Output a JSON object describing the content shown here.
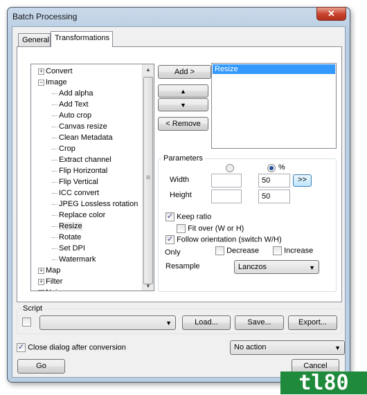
{
  "window": {
    "title": "Batch Processing",
    "close_icon": "close-icon"
  },
  "tabs": [
    {
      "label": "General",
      "active": false
    },
    {
      "label": "Transformations",
      "active": true
    }
  ],
  "tree": {
    "items": [
      {
        "label": "Convert",
        "level": 0,
        "expander": "+"
      },
      {
        "label": "Image",
        "level": 0,
        "expander": "-"
      },
      {
        "label": "Add alpha",
        "level": 1
      },
      {
        "label": "Add Text",
        "level": 1
      },
      {
        "label": "Auto crop",
        "level": 1
      },
      {
        "label": "Canvas resize",
        "level": 1
      },
      {
        "label": "Clean Metadata",
        "level": 1
      },
      {
        "label": "Crop",
        "level": 1
      },
      {
        "label": "Extract channel",
        "level": 1
      },
      {
        "label": "Flip Horizontal",
        "level": 1
      },
      {
        "label": "Flip Vertical",
        "level": 1
      },
      {
        "label": "ICC convert",
        "level": 1
      },
      {
        "label": "JPEG Lossless rotation",
        "level": 1
      },
      {
        "label": "Replace color",
        "level": 1
      },
      {
        "label": "Resize",
        "level": 1,
        "selected": true
      },
      {
        "label": "Rotate",
        "level": 1
      },
      {
        "label": "Set DPI",
        "level": 1
      },
      {
        "label": "Watermark",
        "level": 1
      },
      {
        "label": "Map",
        "level": 0,
        "expander": "+"
      },
      {
        "label": "Filter",
        "level": 0,
        "expander": "+"
      },
      {
        "label": "Noise",
        "level": 0,
        "expander": "+"
      }
    ]
  },
  "buttons": {
    "add": "Add >",
    "up": "▲",
    "down": "▼",
    "remove": "< Remove",
    "more": ">>",
    "load": "Load...",
    "save": "Save...",
    "export": "Export...",
    "go": "Go",
    "cancel": "Cancel"
  },
  "selected_list": [
    "Resize"
  ],
  "parameters": {
    "title": "Parameters",
    "unit_percent": "%",
    "width_label": "Width",
    "height_label": "Height",
    "width_pixels": "",
    "height_pixels": "",
    "width_percent": "50",
    "height_percent": "50",
    "keep_ratio": "Keep ratio",
    "fit_over": "Fit over (W or H)",
    "follow_orientation": "Follow orientation (switch W/H)",
    "only": "Only",
    "decrease": "Decrease",
    "increase": "Increase",
    "resample_label": "Resample",
    "resample_value": "Lanczos"
  },
  "script": {
    "label": "Script",
    "value": ""
  },
  "footer": {
    "close_after": "Close dialog after conversion",
    "action_value": "No action"
  },
  "colors": {
    "selection": "#3399ff",
    "accent": "#1e4f9a"
  }
}
